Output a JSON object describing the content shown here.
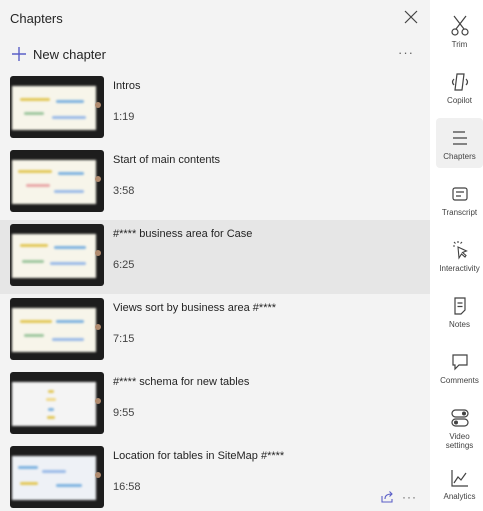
{
  "header": {
    "title": "Chapters"
  },
  "toolbar": {
    "new_chapter_label": "New chapter",
    "more": "···"
  },
  "chapters": [
    {
      "title": "Intros",
      "time": "1:19"
    },
    {
      "title": "Start of main contents",
      "time": "3:58"
    },
    {
      "title": "#**** business area for Case",
      "time": "6:25"
    },
    {
      "title": "Views sort by business area #****",
      "time": "7:15"
    },
    {
      "title": "#**** schema for new tables",
      "time": "9:55"
    },
    {
      "title": "Location for tables in SiteMap #****",
      "time": "16:58"
    }
  ],
  "selected_chapter_index": 2,
  "row_more": "···",
  "rail": [
    {
      "label": "Trim",
      "icon": "scissors-icon"
    },
    {
      "label": "Copilot",
      "icon": "copilot-icon"
    },
    {
      "label": "Chapters",
      "icon": "chapters-icon",
      "active": true
    },
    {
      "label": "Transcript",
      "icon": "transcript-icon"
    },
    {
      "label": "Interactivity",
      "icon": "cursor-click-icon"
    },
    {
      "label": "Notes",
      "icon": "notes-icon"
    },
    {
      "label": "Comments",
      "icon": "comment-icon"
    },
    {
      "label": "Video settings",
      "icon": "toggles-icon"
    },
    {
      "label": "Analytics",
      "icon": "chart-line-icon"
    }
  ],
  "colors": {
    "accent": "#5b5fc7",
    "panel_bg": "#f3f3f3",
    "selected_bg": "#e6e6e6"
  }
}
